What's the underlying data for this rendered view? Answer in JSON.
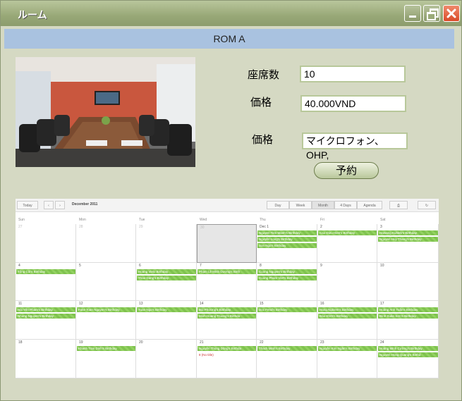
{
  "window": {
    "title": "ルーム",
    "min_icon": "minimize-icon",
    "max_icon": "restore-icon",
    "close_icon": "close-icon"
  },
  "room": {
    "name": "ROM A",
    "seats_label": "座席数",
    "seats_value": "10",
    "price_label": "価格",
    "price_value": "40.000VND",
    "equipment_label": "価格",
    "equipment_value": "マイクロフォン、OHP,",
    "book_label": "予約"
  },
  "calendar": {
    "today_label": "Today",
    "month_label": "December 2011",
    "views": [
      "Day",
      "Week",
      "Month",
      "4 Days",
      "Agenda"
    ],
    "weekdays": [
      "Sun",
      "Mon",
      "Tue",
      "Wed",
      "Thu",
      "Fri",
      "Sat"
    ],
    "weeks": [
      [
        "27",
        "28",
        "29",
        "30",
        "Dec 1",
        "2",
        "3"
      ],
      [
        "4",
        "5",
        "6",
        "7",
        "8",
        "9",
        "10"
      ],
      [
        "11",
        "12",
        "13",
        "14",
        "15",
        "16",
        "17"
      ],
      [
        "18",
        "19",
        "20",
        "21",
        "22",
        "23",
        "24"
      ]
    ],
    "events": [
      {
        "week": 0,
        "day": 4,
        "slot": 0,
        "text": "Nguyen Tien Manh's Birthday"
      },
      {
        "week": 0,
        "day": 4,
        "slot": 1,
        "text": "Nguyễn Long's Birthday"
      },
      {
        "week": 0,
        "day": 4,
        "slot": 2,
        "text": "Son Ngo's Birthday"
      },
      {
        "week": 0,
        "day": 5,
        "slot": 0,
        "text": "Cao Dieu Hien's Birthday"
      },
      {
        "week": 0,
        "day": 6,
        "slot": 0,
        "text": "Hatsang Kuhleb's Birthday"
      },
      {
        "week": 0,
        "day": 6,
        "slot": 1,
        "text": "Nguyen Huy Thang's Birthday"
      },
      {
        "week": 1,
        "day": 0,
        "slot": 0,
        "text": "Tống Côi's Birthday"
      },
      {
        "week": 1,
        "day": 2,
        "slot": 0,
        "text": "Hoang Vietx Birthday"
      },
      {
        "week": 1,
        "day": 2,
        "slot": 1,
        "text": "Thao Dang's Birthday"
      },
      {
        "week": 1,
        "day": 3,
        "slot": 0,
        "text": "Phạm Lê Minh Dương's Birth"
      },
      {
        "week": 1,
        "day": 4,
        "slot": 0,
        "text": "Cuong Nguyen's Birthday"
      },
      {
        "week": 1,
        "day": 4,
        "slot": 1,
        "text": "Cuong Pham Viet's Birthday"
      },
      {
        "week": 2,
        "day": 0,
        "slot": 0,
        "text": "Hải Yến Pham's Birthday"
      },
      {
        "week": 2,
        "day": 0,
        "slot": 1,
        "text": "Nhung Nguyen's Birthday"
      },
      {
        "week": 2,
        "day": 1,
        "slot": 0,
        "text": "Fake Toan Nguyen's Birthday"
      },
      {
        "week": 2,
        "day": 2,
        "slot": 0,
        "text": "Tuan Ngo's Birthday"
      },
      {
        "week": 2,
        "day": 3,
        "slot": 0,
        "text": "Bùi Phương's Birthday"
      },
      {
        "week": 2,
        "day": 3,
        "slot": 1,
        "text": "Minh Hoang Truong's Birthda"
      },
      {
        "week": 2,
        "day": 4,
        "slot": 0,
        "text": "Doc Fend's Birthday"
      },
      {
        "week": 2,
        "day": 5,
        "slot": 0,
        "text": "Hang Nghiem's Birthday"
      },
      {
        "week": 2,
        "day": 5,
        "slot": 1,
        "text": "Đào KhOi's Birthday"
      },
      {
        "week": 2,
        "day": 6,
        "slot": 0,
        "text": "Hoàng Anh Tuấn's Birthday"
      },
      {
        "week": 2,
        "day": 6,
        "slot": 1,
        "text": "Đinh Xuân Sơn's Birthday"
      },
      {
        "week": 3,
        "day": 1,
        "slot": 0,
        "text": "Khanh Tran Dinh's Birthday"
      },
      {
        "week": 3,
        "day": 3,
        "slot": 0,
        "text": "Nguyễn Thùng Dũng's Birthda"
      },
      {
        "week": 3,
        "day": 3,
        "slot": 1,
        "text": "8 (No title)",
        "red": true
      },
      {
        "week": 3,
        "day": 4,
        "slot": 0,
        "text": "Thach Minh's Birthday"
      },
      {
        "week": 3,
        "day": 5,
        "slot": 0,
        "text": "Nguyễn Kim Ngân's Birthday"
      },
      {
        "week": 3,
        "day": 6,
        "slot": 0,
        "text": "Hoàng Minh Cường's Birthday"
      },
      {
        "week": 3,
        "day": 6,
        "slot": 1,
        "text": "Nguyen Hong Quang's Birthd"
      }
    ],
    "highlight": {
      "week": 0,
      "day": 3
    },
    "icons": [
      "chevron-left-icon",
      "chevron-right-icon",
      "print-icon",
      "refresh-icon"
    ]
  }
}
